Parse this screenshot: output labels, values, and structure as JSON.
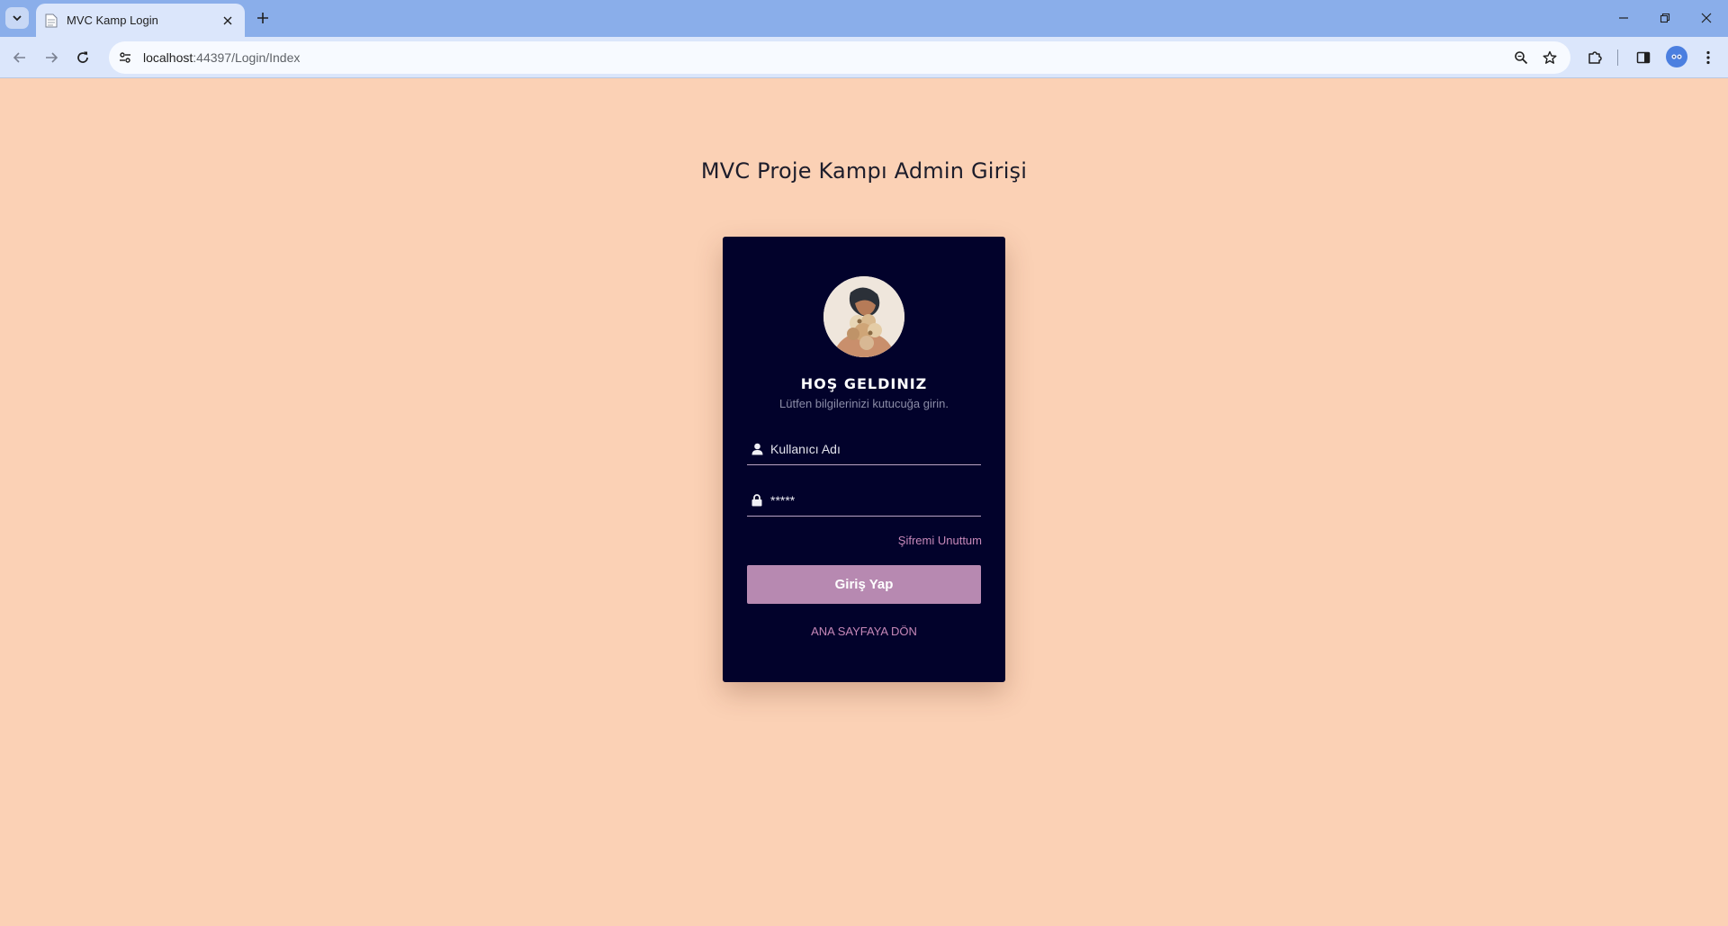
{
  "browser": {
    "tab_title": "MVC Kamp Login",
    "url_host": "localhost",
    "url_path": ":44397/Login/Index"
  },
  "page": {
    "title": "MVC Proje Kampı Admin Girişi"
  },
  "login_card": {
    "welcome": "HOŞ GELDINIZ",
    "subtitle": "Lütfen bilgilerinizi kutucuğa girin.",
    "username_placeholder": "Kullanıcı Adı",
    "password_value": "*****",
    "forgot_label": "Şifremi Unuttum",
    "submit_label": "Giriş Yap",
    "home_label": "ANA SAYFAYA DÖN"
  },
  "colors": {
    "page_background": "#fbd1b5",
    "card_background": "#02022b",
    "accent": "#b789b1",
    "link": "#c688b8"
  }
}
